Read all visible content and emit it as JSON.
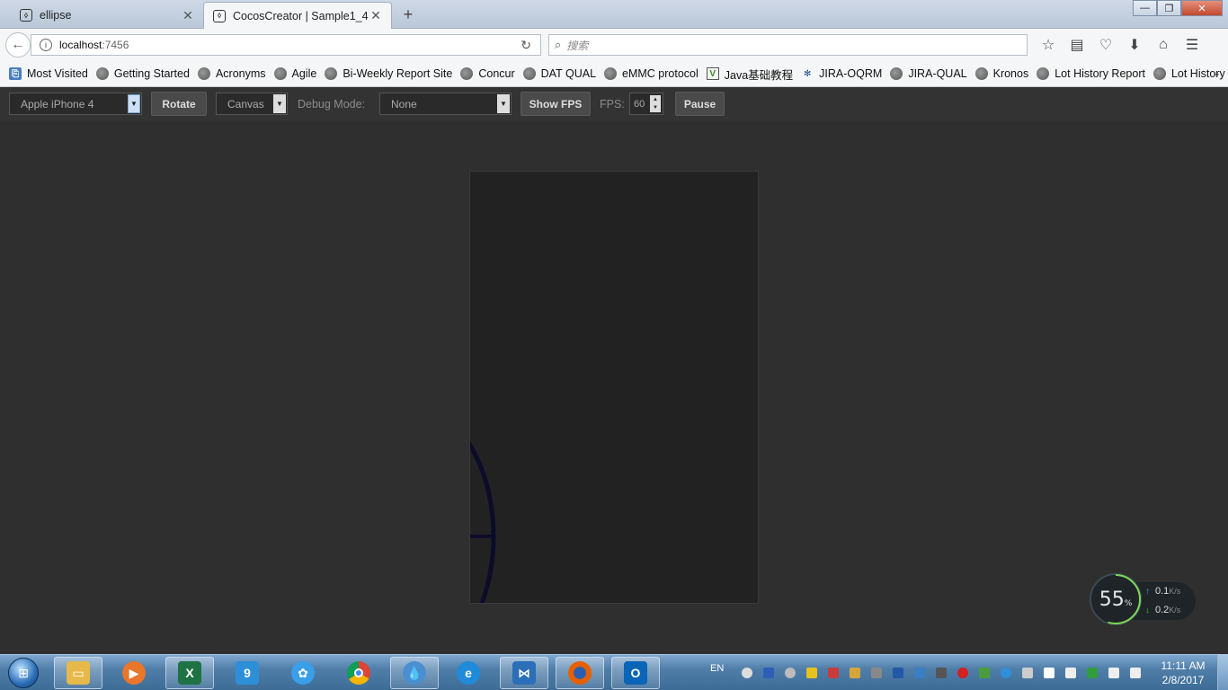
{
  "tabs": [
    {
      "title": "ellipse",
      "active": false
    },
    {
      "title": "CocosCreator | Sample1_4",
      "active": true
    }
  ],
  "window": {
    "minimize": "—",
    "maximize": "❐",
    "close": "✕"
  },
  "url": {
    "host": "localhost",
    "port": ":7456"
  },
  "search": {
    "placeholder": "搜索"
  },
  "bookmarks": [
    "Most Visited",
    "Getting Started",
    "Acronyms",
    "Agile",
    "Bi-Weekly Report Site",
    "Concur",
    "DAT QUAL",
    "eMMC protocol",
    "Java基础教程",
    "JIRA-OQRM",
    "JIRA-QUAL",
    "Kronos",
    "Lot History Report",
    "Lot History"
  ],
  "bookmarks_overflow": "»",
  "cocos_toolbar": {
    "device": "Apple iPhone 4",
    "rotate": "Rotate",
    "renderer": "Canvas",
    "debug_label": "Debug Mode:",
    "debug_value": "None",
    "show_fps": "Show FPS",
    "fps_label": "FPS:",
    "fps_value": "60",
    "pause": "Pause"
  },
  "network": {
    "percent": "55",
    "percent_unit": "%",
    "up_value": "0.1",
    "down_value": "0.2",
    "unit": "K/s",
    "ring_fraction": 0.55
  },
  "taskbar": {
    "lang": "EN",
    "time": "11:11 AM",
    "date": "2/8/2017"
  },
  "colors": {
    "page_bg": "#2f2f2f",
    "canvas_bg": "#222222",
    "ellipse_stroke": "#0d0b2a"
  }
}
